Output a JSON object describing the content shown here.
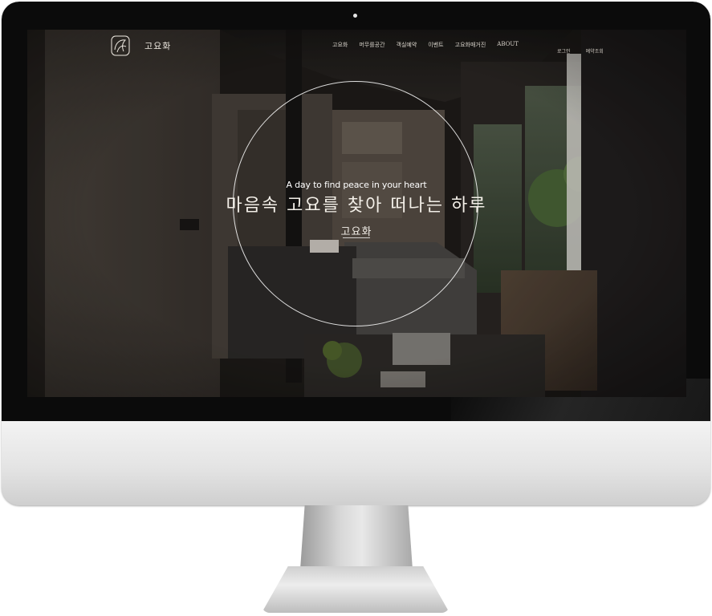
{
  "brand": {
    "name": "고요화"
  },
  "nav": {
    "items": [
      {
        "label": "고요화"
      },
      {
        "label": "머무를공간"
      },
      {
        "label": "객실예약"
      },
      {
        "label": "이벤트"
      },
      {
        "label": "고요화매거진"
      },
      {
        "label": "ABOUT"
      }
    ],
    "utility": [
      {
        "label": "로그인"
      },
      {
        "label": "예약조회"
      }
    ]
  },
  "hero": {
    "tagline_en": "A day to find peace in your heart",
    "headline_ko": "마음속 고요를 찾아 떠나는 하루",
    "brand_caption": "고요화"
  },
  "colors": {
    "bezel": "#0b0b0b",
    "chassis": "#e4e4e4",
    "hero_text": "#f3efe8"
  }
}
